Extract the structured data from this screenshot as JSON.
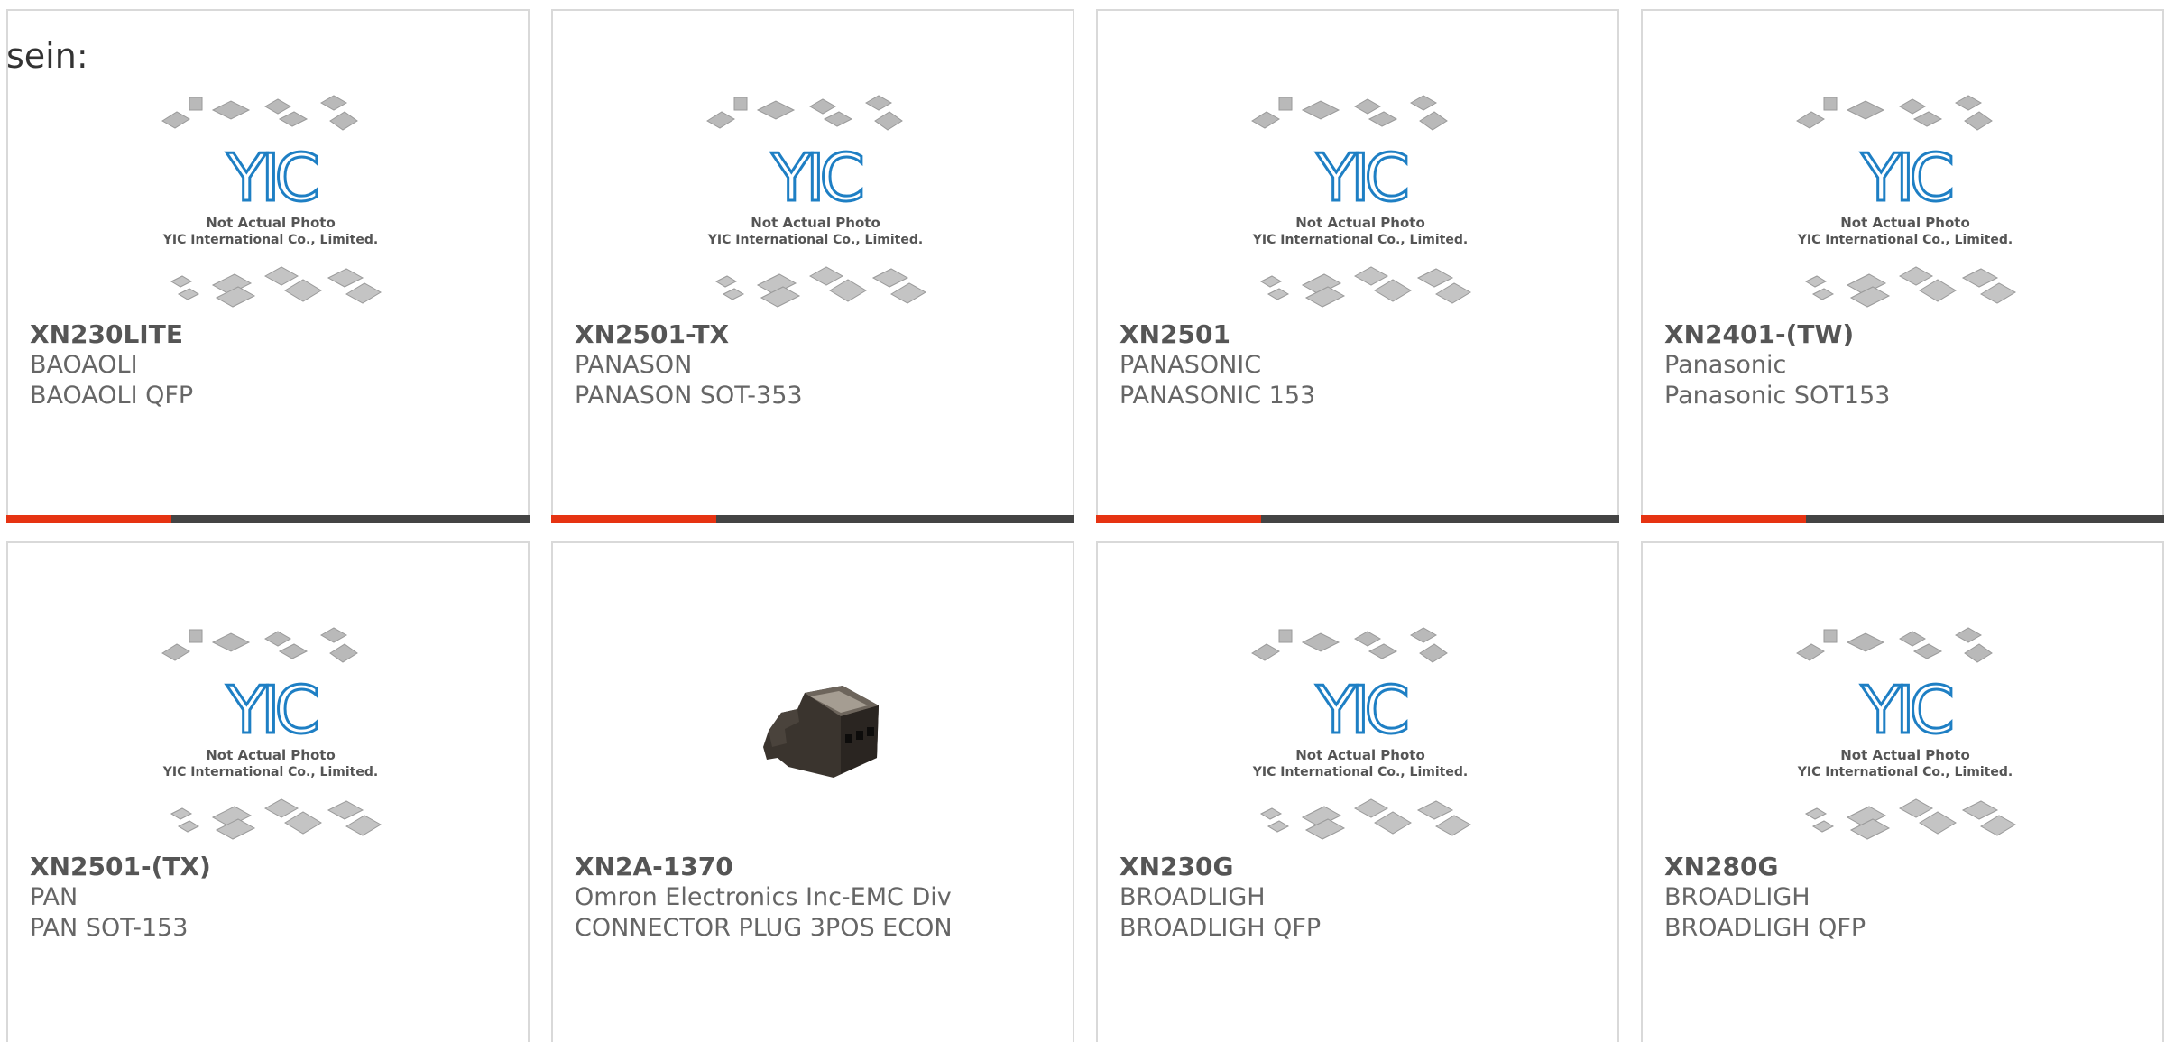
{
  "intro_text": "sein:",
  "placeholder": {
    "logo_text": "YIC",
    "caption1": "Not Actual Photo",
    "caption2": "YIC International Co., Limited."
  },
  "colors": {
    "accent": "#e63312",
    "bar": "#444444",
    "logo_blue": "#1e7fc4"
  },
  "products": [
    {
      "part": "XN230LITE",
      "maker": "BAOAOLI",
      "desc": "BAOAOLI QFP",
      "image": "placeholder"
    },
    {
      "part": "XN2501-TX",
      "maker": "PANASON",
      "desc": "PANASON SOT-353",
      "image": "placeholder"
    },
    {
      "part": "XN2501",
      "maker": "PANASONIC",
      "desc": "PANASONIC 153",
      "image": "placeholder"
    },
    {
      "part": "XN2401-(TW)",
      "maker": "Panasonic",
      "desc": "Panasonic SOT153",
      "image": "placeholder"
    },
    {
      "part": "XN2501-(TX)",
      "maker": "PAN",
      "desc": "PAN SOT-153",
      "image": "placeholder"
    },
    {
      "part": "XN2A-1370",
      "maker": "Omron Electronics Inc-EMC Div",
      "desc": "CONNECTOR PLUG 3POS ECON",
      "image": "connector-photo"
    },
    {
      "part": "XN230G",
      "maker": "BROADLIGH",
      "desc": "BROADLIGH QFP",
      "image": "placeholder"
    },
    {
      "part": "XN280G",
      "maker": "BROADLIGH",
      "desc": "BROADLIGH QFP",
      "image": "placeholder"
    }
  ]
}
